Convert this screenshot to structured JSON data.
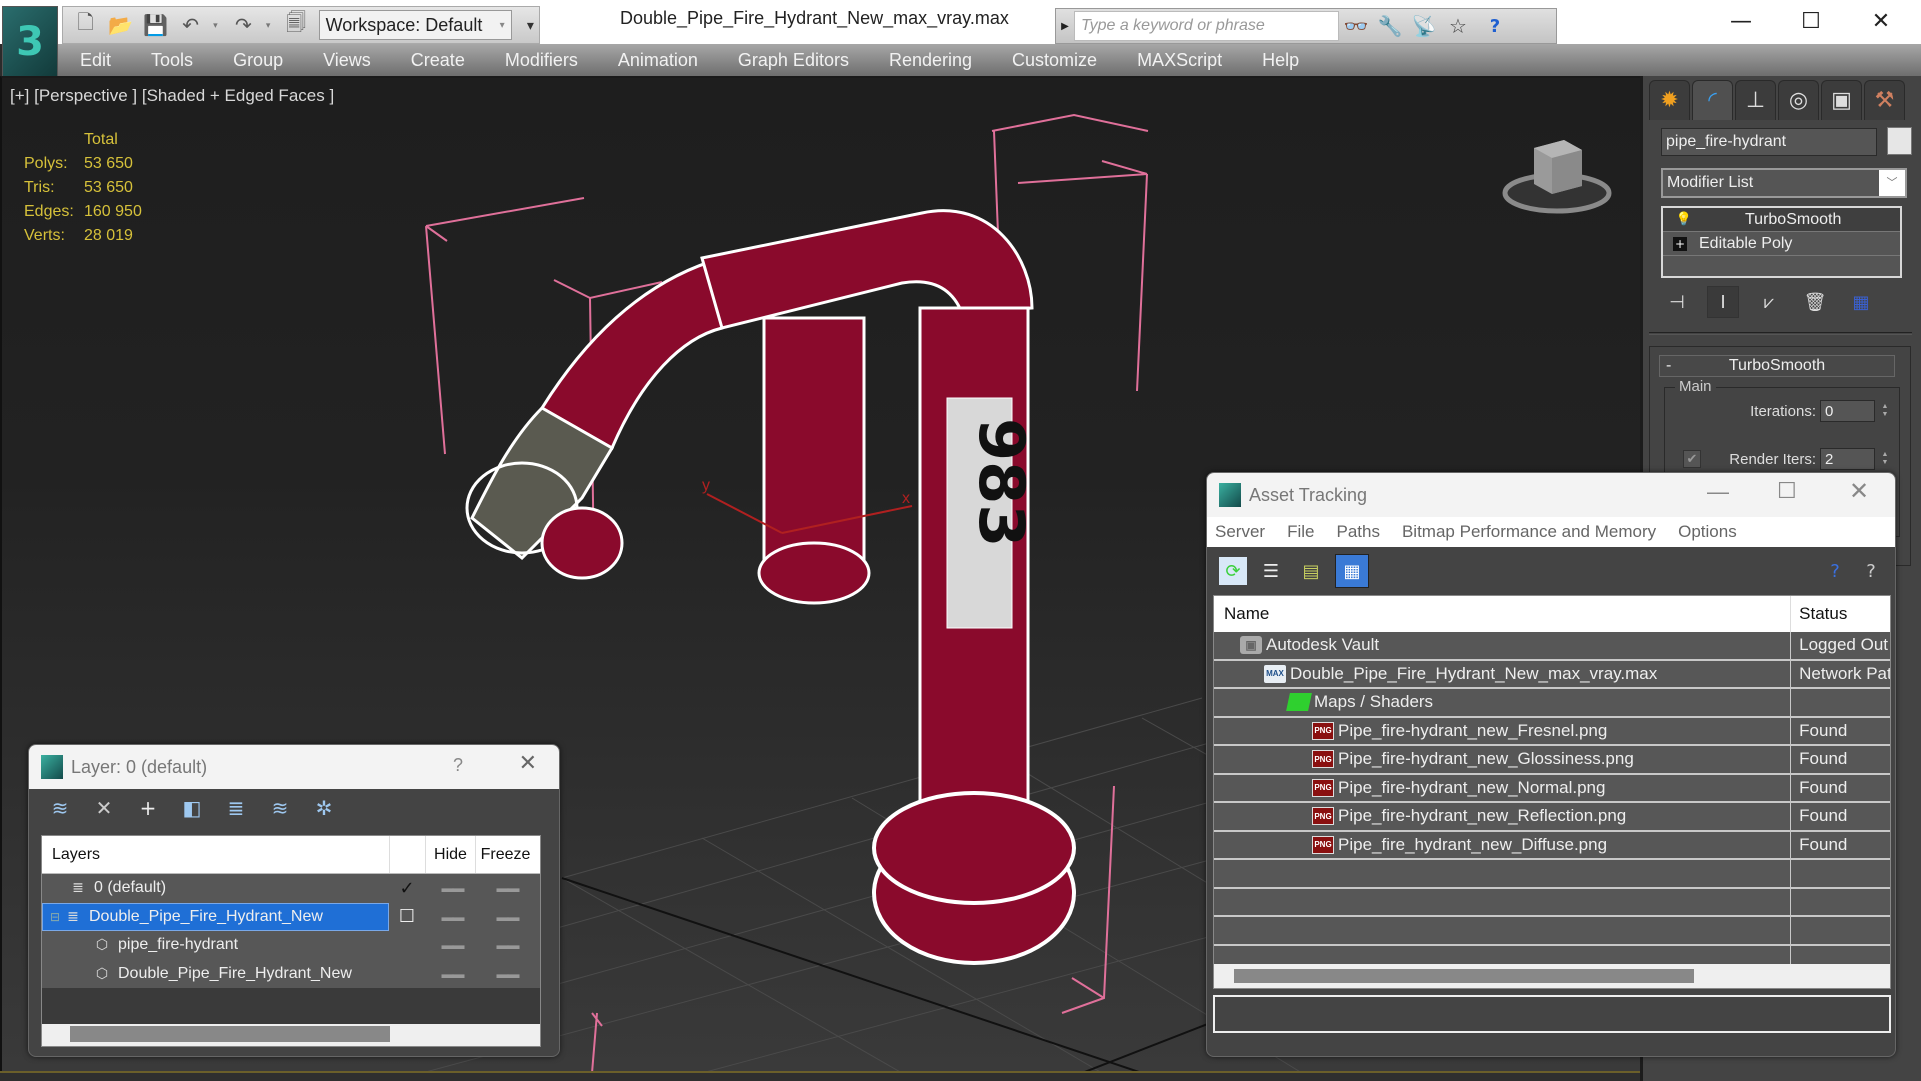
{
  "app": {
    "title": "Double_Pipe_Fire_Hydrant_New_max_vray.max",
    "logo_glyph": "3",
    "workspace": "Workspace: Default",
    "search_placeholder": "Type a keyword or phrase",
    "quick_access": [
      {
        "name": "new-file-icon",
        "glyph": "🗋"
      },
      {
        "name": "open-folder-icon",
        "glyph": "📂"
      },
      {
        "name": "save-icon",
        "glyph": "💾"
      },
      {
        "name": "undo-icon",
        "glyph": "↶"
      },
      {
        "name": "redo-icon",
        "glyph": "↷"
      },
      {
        "name": "project-folder-icon",
        "glyph": "🗐"
      }
    ],
    "search_tools": [
      {
        "name": "binoculars-icon",
        "glyph": "👓"
      },
      {
        "name": "key-icon",
        "glyph": "🔧"
      },
      {
        "name": "satellite-dish-icon",
        "glyph": "📡"
      },
      {
        "name": "star-icon",
        "glyph": "☆"
      }
    ],
    "help_glyph": "?",
    "window_controls": {
      "minimize": "—",
      "maximize": "☐",
      "close": "✕"
    }
  },
  "menu": [
    "Edit",
    "Tools",
    "Group",
    "Views",
    "Create",
    "Modifiers",
    "Animation",
    "Graph Editors",
    "Rendering",
    "Customize",
    "MAXScript",
    "Help"
  ],
  "viewport": {
    "label_parts": [
      "[+]",
      "[Perspective ]",
      "[Shaded + Edged Faces ]"
    ],
    "stats_header": "Total",
    "stats": [
      {
        "label": "Polys:",
        "value": "53 650"
      },
      {
        "label": "Tris:",
        "value": "53 650"
      },
      {
        "label": "Edges:",
        "value": "160 950"
      },
      {
        "label": "Verts:",
        "value": "28 019"
      }
    ],
    "model_label": "983",
    "axis_x": "x",
    "axis_y": "y",
    "model_color": "#8a0a2c",
    "bbox_color": "#e0709a"
  },
  "command_panel": {
    "tabs": [
      {
        "name": "create-tab-icon",
        "glyph": "✹",
        "color": "#f0a020"
      },
      {
        "name": "modify-tab-icon",
        "glyph": "◜",
        "color": "#3aa0f0"
      },
      {
        "name": "hierarchy-tab-icon",
        "glyph": "⊥",
        "color": "#ddd"
      },
      {
        "name": "motion-tab-icon",
        "glyph": "◎",
        "color": "#ddd"
      },
      {
        "name": "display-tab-icon",
        "glyph": "▣",
        "color": "#ddd"
      },
      {
        "name": "utilities-tab-icon",
        "glyph": "⚒",
        "color": "#d08060"
      }
    ],
    "object_name": "pipe_fire-hydrant",
    "modifier_list": "Modifier List",
    "stack": [
      {
        "label": "TurboSmooth",
        "icon": "💡"
      },
      {
        "label": "Editable Poly",
        "icon": "+"
      }
    ],
    "stack_tools": [
      {
        "name": "pin-stack-icon",
        "glyph": "⊣"
      },
      {
        "name": "show-end-result-icon",
        "glyph": "I"
      },
      {
        "name": "make-unique-icon",
        "glyph": "⩗"
      },
      {
        "name": "remove-modifier-icon",
        "glyph": "🗑"
      },
      {
        "name": "configure-modifier-sets-icon",
        "glyph": "▦"
      }
    ],
    "rollout": {
      "title": "TurboSmooth",
      "collapse": "-",
      "group": "Main",
      "iterations_label": "Iterations:",
      "iterations": "0",
      "render_iters_label": "Render Iters:",
      "render_iters": "2",
      "render_iters_checked": true
    }
  },
  "layer_dialog": {
    "title": "Layer: 0 (default)",
    "help": "?",
    "close": "✕",
    "tools": [
      {
        "name": "create-layer-icon",
        "glyph": "≋"
      },
      {
        "name": "delete-layer-icon",
        "glyph": "✕"
      },
      {
        "name": "add-to-layer-icon",
        "glyph": "+"
      },
      {
        "name": "select-objects-icon",
        "glyph": "◧"
      },
      {
        "name": "select-layer-icon",
        "glyph": "≣"
      },
      {
        "name": "set-current-layer-icon",
        "glyph": "≋"
      },
      {
        "name": "layer-settings-icon",
        "glyph": "✲"
      }
    ],
    "columns": [
      "Layers",
      "",
      "Hide",
      "Freeze"
    ],
    "rows": [
      {
        "name": "0 (default)",
        "icon": "≣",
        "current": "✓",
        "indent": 1,
        "selected": false
      },
      {
        "name": "Double_Pipe_Fire_Hydrant_New",
        "icon": "≣",
        "current": "☐",
        "indent": 0,
        "selected": true,
        "expander": "⊟"
      },
      {
        "name": "pipe_fire-hydrant",
        "icon": "⬡",
        "current": "",
        "indent": 2,
        "selected": false
      },
      {
        "name": "Double_Pipe_Fire_Hydrant_New",
        "icon": "⬡",
        "current": "",
        "indent": 2,
        "selected": false
      }
    ],
    "dash": "▬▬"
  },
  "asset_dialog": {
    "title": "Asset Tracking",
    "controls": {
      "minimize": "—",
      "maximize": "☐",
      "close": "✕"
    },
    "menu": [
      "Server",
      "File",
      "Paths",
      "Bitmap Performance and Memory",
      "Options"
    ],
    "tools": [
      {
        "name": "refresh-icon",
        "glyph": "⟳",
        "color": "#3ad03a"
      },
      {
        "name": "list-view-icon",
        "glyph": "☰",
        "color": "#eee"
      },
      {
        "name": "tree-view-icon",
        "glyph": "▤",
        "color": "#c8d060"
      },
      {
        "name": "table-view-icon",
        "glyph": "▦",
        "color": "#fff"
      }
    ],
    "help_tools": [
      {
        "name": "online-help-icon",
        "glyph": "?",
        "color": "#3a70e0"
      },
      {
        "name": "context-help-icon",
        "glyph": "?",
        "color": "#ccc"
      }
    ],
    "columns": [
      "Name",
      "Status"
    ],
    "rows": [
      {
        "name": "Autodesk Vault",
        "status": "Logged Out",
        "icon": "vault",
        "indent": 1
      },
      {
        "name": "Double_Pipe_Fire_Hydrant_New_max_vray.max",
        "status": "Network Path",
        "icon": "max",
        "indent": 2
      },
      {
        "name": "Maps / Shaders",
        "status": "",
        "icon": "maps",
        "indent": 3
      },
      {
        "name": "Pipe_fire-hydrant_new_Fresnel.png",
        "status": "Found",
        "icon": "png",
        "indent": 4
      },
      {
        "name": "Pipe_fire-hydrant_new_Glossiness.png",
        "status": "Found",
        "icon": "png",
        "indent": 4
      },
      {
        "name": "Pipe_fire-hydrant_new_Normal.png",
        "status": "Found",
        "icon": "png",
        "indent": 4
      },
      {
        "name": "Pipe_fire-hydrant_new_Reflection.png",
        "status": "Found",
        "icon": "png",
        "indent": 4
      },
      {
        "name": "Pipe_fire_hydrant_new_Diffuse.png",
        "status": "Found",
        "icon": "png",
        "indent": 4
      }
    ],
    "empty_rows": 4
  }
}
